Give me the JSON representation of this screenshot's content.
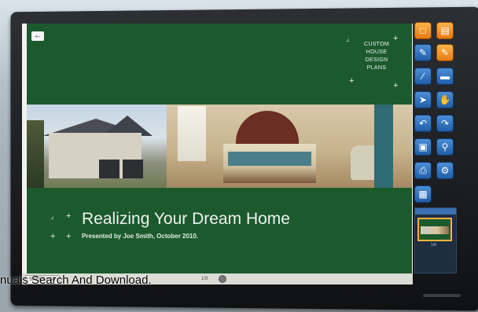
{
  "slide": {
    "brand_lines": [
      "CUSTOM",
      "HOUSE",
      "DESIGN",
      "PLANS"
    ],
    "title": "Realizing Your Dream Home",
    "subtitle": "Presented by Joe Smith, October 2010."
  },
  "screen_bar": {
    "sheet_tab": "SHEET LIST",
    "page_indicator": "1/8"
  },
  "palette": {
    "tools": [
      {
        "icon": "new-page-icon",
        "color": "orange"
      },
      {
        "icon": "folder-icon",
        "color": "orange"
      },
      {
        "icon": "pen-icon",
        "color": "blue"
      },
      {
        "icon": "highlighter-icon",
        "color": "orange"
      },
      {
        "icon": "line-icon",
        "color": "blue"
      },
      {
        "icon": "eraser-icon",
        "color": "blue"
      },
      {
        "icon": "pointer-icon",
        "color": "blue"
      },
      {
        "icon": "hand-icon",
        "color": "blue"
      },
      {
        "icon": "undo-icon",
        "color": "blue"
      },
      {
        "icon": "redo-icon",
        "color": "blue"
      },
      {
        "icon": "capture-icon",
        "color": "blue"
      },
      {
        "icon": "zoom-icon",
        "color": "blue"
      },
      {
        "icon": "print-icon",
        "color": "blue"
      },
      {
        "icon": "settings-icon",
        "color": "blue"
      },
      {
        "icon": "screen-icon",
        "color": "blue"
      }
    ],
    "thumb_label": "1/8"
  },
  "watermark": "nuals Search And Download."
}
